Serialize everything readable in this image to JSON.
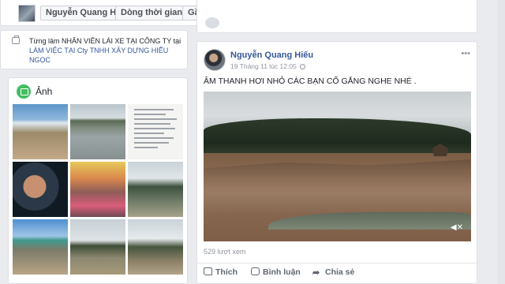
{
  "navbar": {
    "profile_name": "Nguyễn Quang Hiếu",
    "filter_label": "Dòng thời gian",
    "sort_label": "Gần đây"
  },
  "intro": {
    "text_line1": "Từng làm NHÂN VIÊN LÁI XE TẠI CÔNG TY tại",
    "link_text": "LÀM VIỆC TẠI Cty TNHH XÂY DỰNG HIẾU NGỌC"
  },
  "photos": {
    "title": "Ảnh",
    "items": [
      "photo-1",
      "photo-2",
      "photo-3",
      "photo-4",
      "photo-5",
      "photo-6",
      "photo-7",
      "photo-8",
      "photo-9"
    ]
  },
  "post": {
    "author": "Nguyễn Quang Hiếu",
    "timestamp": "19 Tháng 11 lúc 12:05",
    "text": "ÂM THANH HƠI NHỎ CÁC BẠN CỐ GẮNG NGHE NHÉ .",
    "views": "529 lượt xem",
    "actions": {
      "like": "Thích",
      "comment": "Bình luận",
      "share": "Chia sẻ"
    },
    "more_icon": "more-icon",
    "privacy_icon": "globe-icon",
    "mute_icon": "mute-icon"
  },
  "colors": {
    "link": "#365899",
    "background": "#e9ebee",
    "muted_text": "#90949c",
    "photos_icon": "#45bd62"
  }
}
